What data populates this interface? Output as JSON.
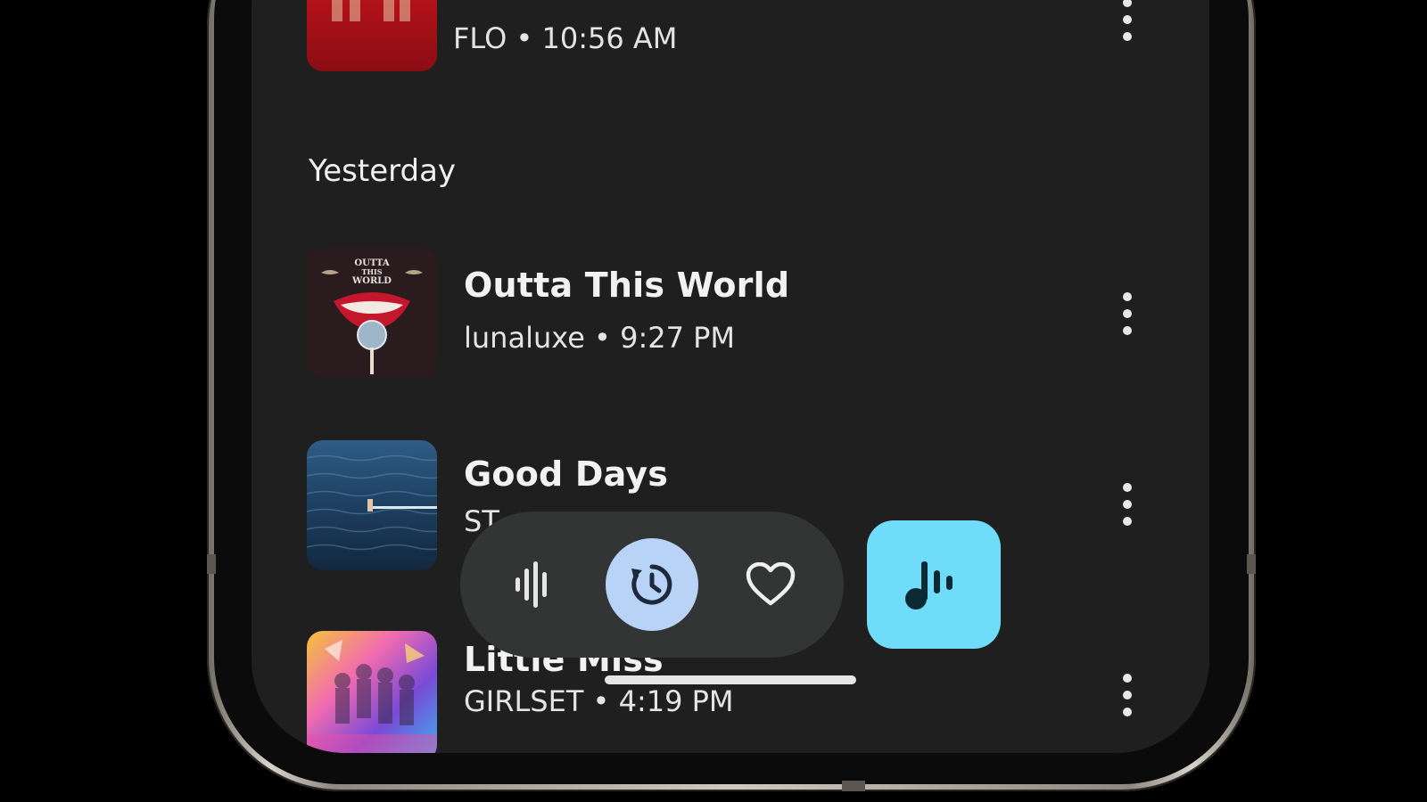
{
  "history": {
    "items_today": [
      {
        "artist": "FLO",
        "time": "10:56 AM",
        "subtitle": "FLO • 10:56 AM",
        "art_colors": [
          "#8e0d12",
          "#c2141b"
        ]
      }
    ],
    "section_yesterday": "Yesterday",
    "items_yesterday": [
      {
        "title": "Outta This World",
        "artist": "lunaluxe",
        "time": "9:27 PM",
        "subtitle": "lunaluxe • 9:27 PM",
        "art_text": "OUTTA THIS WORLD",
        "art_colors": [
          "#2b1a1c",
          "#c0182a"
        ]
      },
      {
        "title": "Good Days",
        "subtitle_partial": "ST",
        "art_colors": [
          "#1c3a5c",
          "#4f7aa0"
        ]
      },
      {
        "title": "Little Miss",
        "artist": "GIRLSET",
        "time": "4:19 PM",
        "subtitle": "GIRLSET • 4:19 PM",
        "art_colors": [
          "#f5a623",
          "#d63fb4",
          "#3a7bd5"
        ]
      }
    ]
  },
  "nav": {
    "items": [
      {
        "icon": "waveform-icon",
        "active": false
      },
      {
        "icon": "history-icon",
        "active": true
      },
      {
        "icon": "heart-icon",
        "active": false
      }
    ],
    "fab_icon": "music-note-waveform-icon"
  },
  "colors": {
    "screen_bg": "#1f1f1f",
    "nav_pill_bg": "#333434",
    "nav_active_bg": "#b9d3f7",
    "fab_bg": "#6fdcf9",
    "text_primary": "#f2f2f2"
  }
}
